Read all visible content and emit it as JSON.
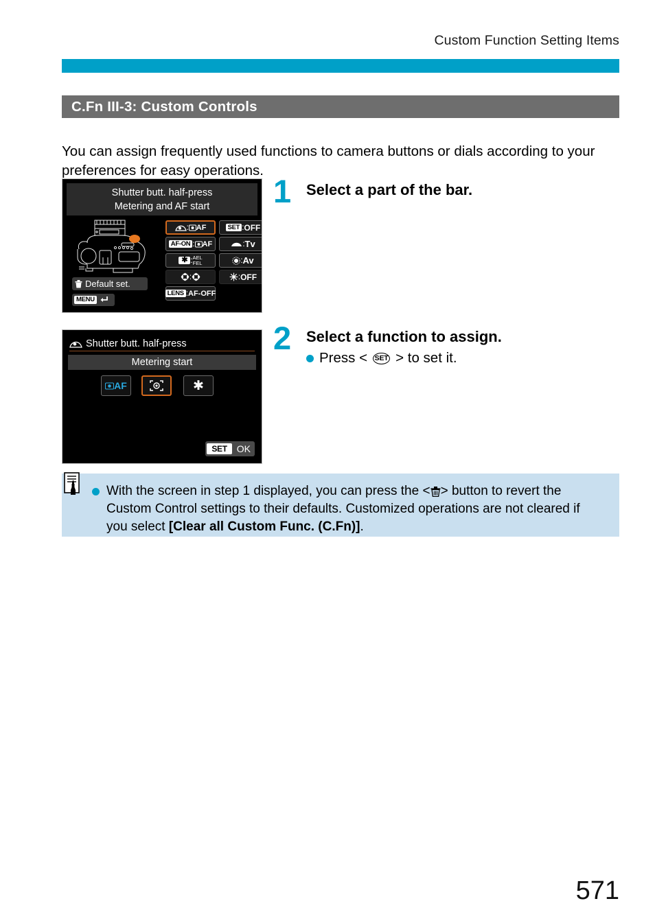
{
  "running_head": "Custom Function Setting Items",
  "section": {
    "title": "C.Fn III-3: Custom Controls"
  },
  "intro": "You can assign frequently used functions to camera buttons or dials according to your preferences for easy operations.",
  "screen1": {
    "title_line1": "Shutter butt. half-press",
    "title_line2": "Metering and AF start",
    "default_set_label": "Default set.",
    "menu_label": "MENU",
    "grid": [
      {
        "key": "shutter-button-half-press",
        "key_label": "",
        "sep": ":",
        "value": "AF",
        "selected": true
      },
      {
        "key": "af-on-button",
        "key_label": "AF-ON",
        "sep": ":",
        "value": "AF",
        "selected": false
      },
      {
        "key": "ae-lock-button",
        "key_label": "",
        "sep": ":",
        "value": "AEL FEL",
        "selected": false
      },
      {
        "key": "depth-of-field-preview-button",
        "key_label": "",
        "sep": ":",
        "value": "",
        "selected": false
      },
      {
        "key": "lens-af-stop-button",
        "key_label": "LENS",
        "sep": ":",
        "value": "AF-OFF",
        "selected": false
      },
      {
        "key": "set-button",
        "key_label": "SET",
        "sep": ":",
        "value": "OFF",
        "selected": false
      },
      {
        "key": "main-dial",
        "key_label": "",
        "sep": ":",
        "value": "Tv",
        "selected": false
      },
      {
        "key": "quick-control-dial",
        "key_label": "",
        "sep": ":",
        "value": "Av",
        "selected": false
      },
      {
        "key": "multi-controller",
        "key_label": "",
        "sep": ":",
        "value": "OFF",
        "selected": false
      }
    ]
  },
  "screen2": {
    "header": "Shutter butt. half-press",
    "subheader": "Metering start",
    "options": [
      {
        "name": "metering-and-af-start",
        "label": "AF",
        "selected": false
      },
      {
        "name": "metering-start",
        "label": "",
        "selected": true
      },
      {
        "name": "ae-lock",
        "label": "",
        "selected": false
      }
    ],
    "set_label": "SET",
    "ok_label": "OK"
  },
  "steps": [
    {
      "number": "1",
      "heading": "Select a part of the bar.",
      "bullets": []
    },
    {
      "number": "2",
      "heading": "Select a function to assign.",
      "bullets": [
        {
          "pre": "Press <",
          "glyph": "SET",
          "post": "> to set it."
        }
      ]
    }
  ],
  "note": {
    "icon": "note-pencil-icon",
    "text_part1": "With the screen in step 1 displayed, you can press the <",
    "glyph": "trash-icon",
    "text_part2": "> button to revert the Custom Control settings to their defaults. Customized operations are not cleared if you select ",
    "bold_text": "[Clear all Custom Func. (C.Fn)]",
    "text_part3": "."
  },
  "page_number": "571",
  "colors": {
    "accent_cyan": "#00A0C8",
    "section_gray": "#6E6E6E",
    "note_blue": "#C9DFEF",
    "selection_orange": "#D2691E",
    "screen_black": "#000000"
  }
}
